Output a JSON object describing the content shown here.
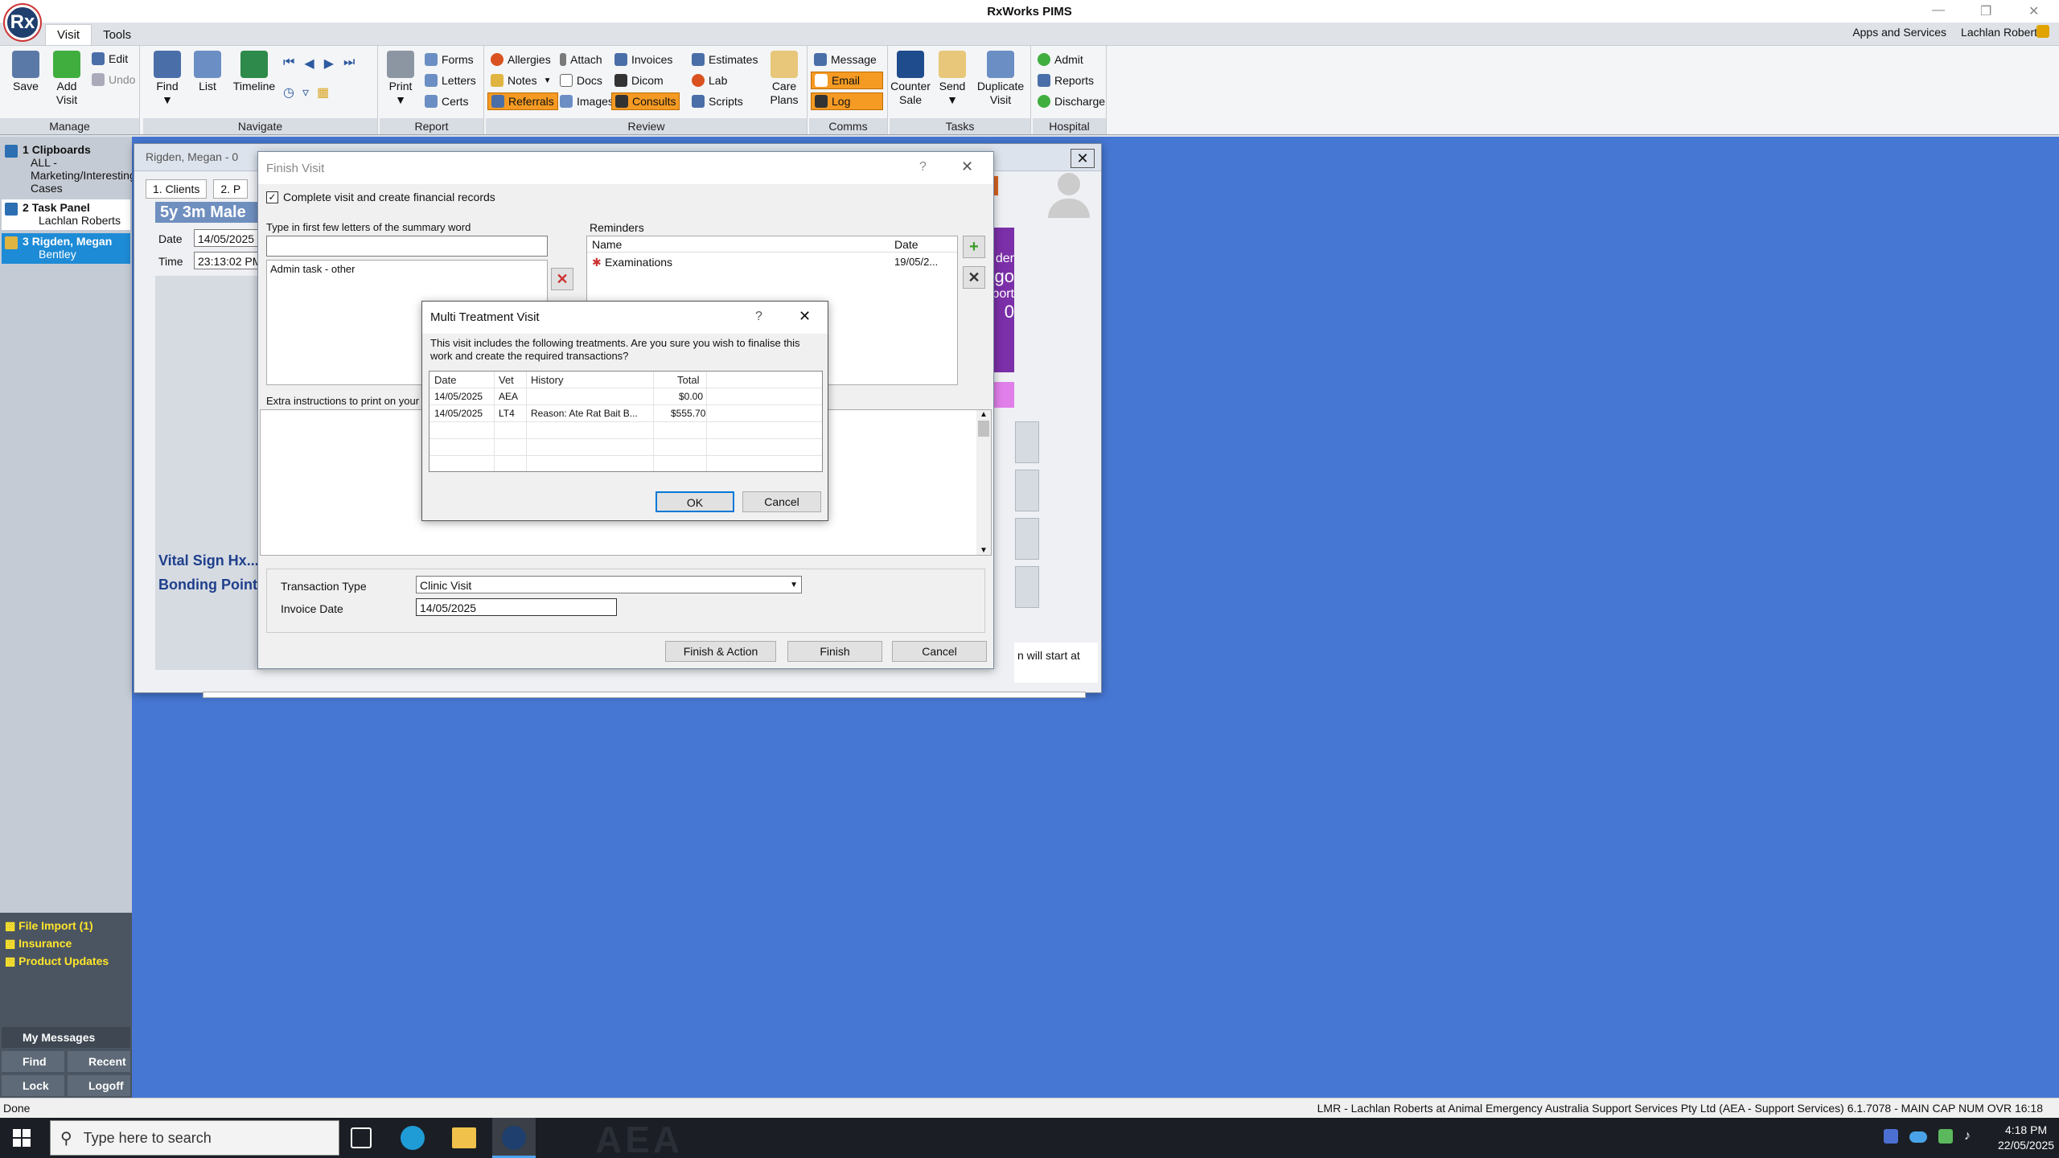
{
  "app": {
    "title": "RxWorks PIMS",
    "logo_text": "Rx"
  },
  "menu_tabs": [
    "Visit",
    "Tools"
  ],
  "topright": {
    "apps": "Apps and Services",
    "user": "Lachlan Roberts"
  },
  "ribbon": {
    "manage": {
      "label": "Manage",
      "save": "Save",
      "add_visit": "Add Visit",
      "edit": "Edit",
      "undo": "Undo"
    },
    "navigate": {
      "label": "Navigate",
      "find": "Find",
      "list": "List",
      "timeline": "Timeline"
    },
    "report": {
      "label": "Report",
      "print": "Print",
      "forms": "Forms",
      "letters": "Letters",
      "certs": "Certs"
    },
    "review": {
      "label": "Review",
      "allergies": "Allergies",
      "attach": "Attach",
      "invoices": "Invoices",
      "estimates": "Estimates",
      "notes": "Notes",
      "docs": "Docs",
      "dicom": "Dicom",
      "lab": "Lab",
      "referrals": "Referrals",
      "images": "Images",
      "consults": "Consults",
      "scripts": "Scripts",
      "care_plans": "Care Plans"
    },
    "comms": {
      "label": "Comms",
      "message": "Message",
      "email": "Email",
      "log": "Log"
    },
    "tasks": {
      "label": "Tasks",
      "counter_sale": "Counter Sale",
      "send": "Send",
      "duplicate_visit": "Duplicate Visit"
    },
    "hospital": {
      "label": "Hospital",
      "admit": "Admit",
      "reports": "Reports",
      "discharge": "Discharge"
    }
  },
  "sidebar": {
    "items": [
      {
        "num": "1",
        "title": "Clipboards",
        "sub": "ALL - Marketing/Interesting Cases"
      },
      {
        "num": "2",
        "title": "Task Panel",
        "sub": "Lachlan Roberts"
      },
      {
        "num": "3",
        "title": "Rigden, Megan",
        "sub": "Bentley"
      }
    ],
    "links": [
      "File Import (1)",
      "Insurance",
      "Product Updates"
    ],
    "my_messages": "My Messages",
    "find": "Find",
    "recent": "Recent",
    "lock": "Lock",
    "logoff": "Logoff"
  },
  "patient_window": {
    "title": "Rigden, Megan - 0",
    "tab_clients": "1. Clients",
    "tab_2": "2. P",
    "header": "5y 3m Male Ne",
    "date_label": "Date",
    "date": "14/05/2025",
    "time_label": "Time",
    "time": "23:13:02 PM",
    "vital": "Vital Sign Hx...",
    "bonding": "Bonding Points",
    "right_texts": [
      "der",
      "go",
      "port",
      "0"
    ],
    "bottom_text": "n will start at"
  },
  "finish_visit": {
    "title": "Finish Visit",
    "help": "?",
    "complete_label": "Complete visit and create financial records",
    "summary_label": "Type in first few letters of the summary word",
    "summary_input": "",
    "summary_item": "Admin task - other",
    "reminders_label": "Reminders",
    "rem_col_name": "Name",
    "rem_col_date": "Date",
    "reminders": [
      {
        "name": "Examinations",
        "date": "19/05/2..."
      }
    ],
    "extra_label": "Extra instructions to print on your in",
    "transaction_type_label": "Transaction Type",
    "transaction_type": "Clinic Visit",
    "invoice_date_label": "Invoice Date",
    "invoice_date": "14/05/2025",
    "finish_action": "Finish & Action",
    "finish": "Finish",
    "cancel": "Cancel"
  },
  "multi_treatment": {
    "title": "Multi Treatment Visit",
    "help": "?",
    "message": "This visit includes the following treatments.  Are you sure you wish to finalise this work and create the required transactions?",
    "columns": {
      "date": "Date",
      "vet": "Vet",
      "history": "History",
      "total": "Total"
    },
    "rows": [
      {
        "date": "14/05/2025",
        "vet": "AEA",
        "history": "",
        "total": "$0.00"
      },
      {
        "date": "14/05/2025",
        "vet": "LT4",
        "history": "Reason: Ate Rat Bait B...",
        "total": "$555.70"
      }
    ],
    "ok": "OK",
    "cancel": "Cancel"
  },
  "status": {
    "left": "Done",
    "right": "LMR - Lachlan Roberts at Animal Emergency Australia Support Services Pty Ltd (AEA - Support Services) 6.1.7078 - MAIN  CAP  NUM  OVR  16:18"
  },
  "taskbar": {
    "search_placeholder": "Type here to search",
    "time": "4:18 PM",
    "date": "22/05/2025",
    "watermark": "AEA"
  },
  "colors": {
    "desktop": "#4677d3",
    "sidebar": "#c5cbd4",
    "selected": "#1e8bd6",
    "orange": "#f59a23",
    "purple": "#7b2fa8",
    "pink": "#e07fe9"
  }
}
